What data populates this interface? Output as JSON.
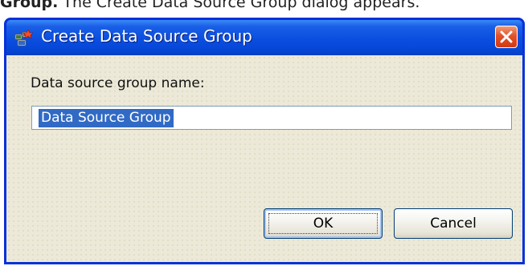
{
  "doc": {
    "prefix": "Group.",
    "text": " The Create Data Source Group dialog appears."
  },
  "dialog": {
    "title": "Create Data Source Group",
    "field_label": "Data source group name:",
    "name_value": "Data Source Group",
    "ok_label": "OK",
    "cancel_label": "Cancel",
    "icons": {
      "title": "data-source-group-icon",
      "close": "close-icon"
    },
    "colors": {
      "titlebar": "#0a4ee0",
      "close_button": "#e2512a",
      "client_bg": "#ece9d8",
      "selection": "#316ac5"
    }
  }
}
